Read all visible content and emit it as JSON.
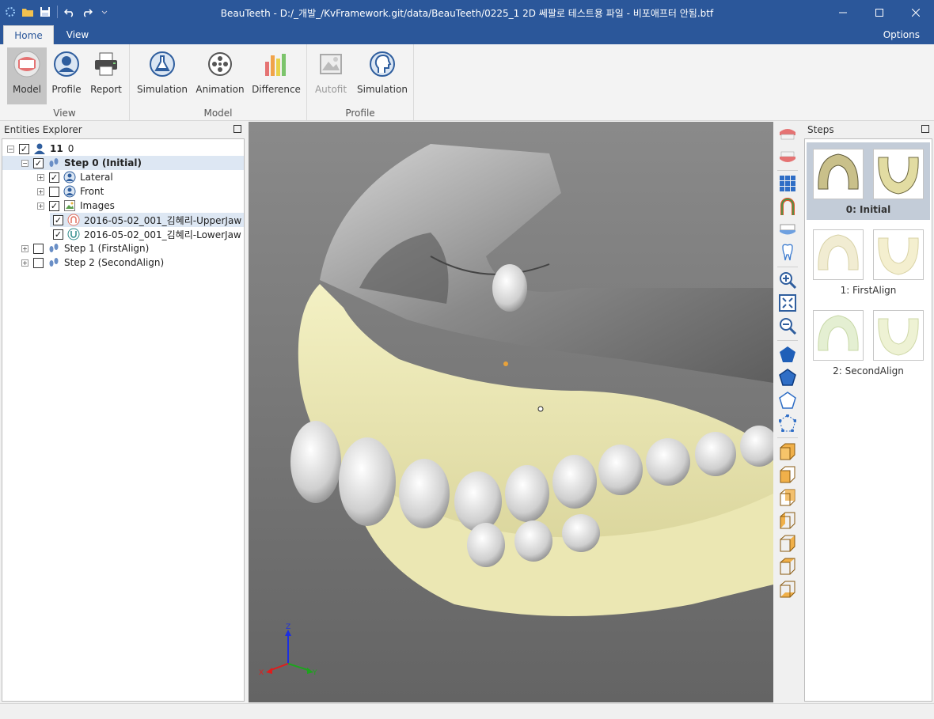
{
  "window": {
    "title": "BeauTeeth - D:/_개발_/KvFramework.git/data/BeauTeeth/0225_1 2D 쎄팔로 테스트용 파일 - 비포애프터 안됨.btf"
  },
  "ribbon": {
    "tabs": [
      "Home",
      "View"
    ],
    "options_label": "Options",
    "groups": [
      {
        "title": "View",
        "buttons": [
          "Model",
          "Profile",
          "Report"
        ]
      },
      {
        "title": "Model",
        "buttons": [
          "Simulation",
          "Animation",
          "Difference"
        ]
      },
      {
        "title": "Profile",
        "buttons": [
          "Autofit",
          "Simulation"
        ]
      }
    ]
  },
  "explorer": {
    "title": "Entities Explorer",
    "root": {
      "number": "11",
      "name": "0"
    },
    "nodes": [
      "Step 0 (Initial)",
      "Lateral",
      "Front",
      "Images",
      "2016-05-02_001_김혜리-UpperJaw",
      "2016-05-02_001_김혜리-LowerJaw",
      "Step 1 (FirstAlign)",
      "Step 2 (SecondAlign)"
    ]
  },
  "steps_panel": {
    "title": "Steps",
    "items": [
      "0: Initial",
      "1: FirstAlign",
      "2: SecondAlign"
    ]
  },
  "axes": {
    "x": "X",
    "y": "Y",
    "z": "Z"
  },
  "colors": {
    "titlebar": "#2b579a",
    "jaw": "#ede9b2",
    "viewport": "#777777"
  }
}
